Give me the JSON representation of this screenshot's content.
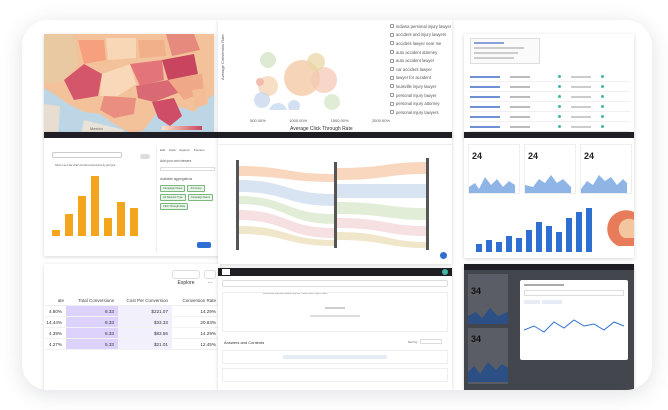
{
  "scatter": {
    "y_axis_label": "Average Conversion Rate",
    "x_axis_label": "Average Click Through Rate",
    "x_ticks": [
      "500.00%",
      "1000.00%",
      "1500.00%",
      "2000.00%"
    ],
    "legend": [
      "indiana personal injury lawyer",
      "accident and injury lawyers",
      "accident lawyer near me",
      "auto accident attorney",
      "auto accident lawyer",
      "car accident lawyer",
      "lawyer for accident",
      "louisville injury lawyer",
      "personal injury lawyer",
      "personal injury attorney",
      "personal injury lawyers"
    ]
  },
  "map": {
    "label": "Mexico"
  },
  "bars": {
    "query": "Show me a bar chart of total conversions by job type",
    "tabs": [
      "Edit",
      "Data",
      "Explore",
      "Preview"
    ],
    "panel_title": "Add your own viewers",
    "panel_sub": "Available aggregations",
    "chips": [
      "Campaign Name",
      "Ad Group",
      "Ad Network Type",
      "Campaign Name",
      "Click Through Rate"
    ],
    "button": "Save"
  },
  "kpi": {
    "values": [
      "24",
      "24",
      "24"
    ]
  },
  "table": {
    "explore_label": "Explore",
    "more_label": "···",
    "columns": [
      "Total Conversions",
      "Cost Per Conversion",
      "Conversion Rate"
    ],
    "first_col_header": "ate",
    "rows": [
      {
        "rate": "4.80%",
        "conv": "8.33",
        "cost": "$221.07",
        "cr": "14.29%"
      },
      {
        "rate": "14.44%",
        "conv": "8.33",
        "cost": "$33.33",
        "cr": "20.83%"
      },
      {
        "rate": "4.39%",
        "conv": "8.33",
        "cost": "$83.56",
        "cr": "14.29%"
      },
      {
        "rate": "4.27%",
        "conv": "5.33",
        "cost": "$21.01",
        "cr": "12.45%"
      }
    ]
  },
  "ask": {
    "placeholder": "What are people searching for most often right now?",
    "section": "Answers and Contents",
    "sort_label": "Sort by"
  },
  "dark_panel": {
    "value": "34"
  },
  "colors": {
    "accent_blue": "#2f6fd1",
    "bar_orange": "#f3a51d",
    "map_red": "#d4566a"
  }
}
